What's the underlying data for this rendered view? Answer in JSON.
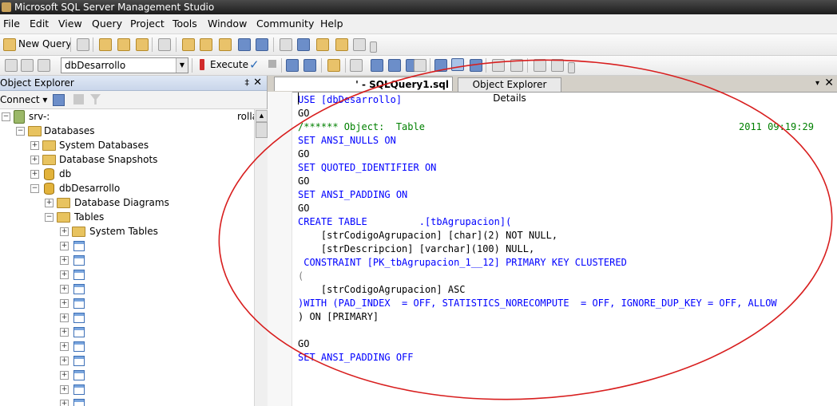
{
  "window": {
    "title": "Microsoft SQL Server Management Studio"
  },
  "menu": [
    "File",
    "Edit",
    "View",
    "Query",
    "Project",
    "Tools",
    "Window",
    "Community",
    "Help"
  ],
  "toolbar": {
    "new_query_label": "New Query",
    "database_selected": "dbDesarrollo",
    "execute_label": "Execute"
  },
  "object_explorer": {
    "title": "Object Explorer",
    "pin": "‡",
    "close": "✕",
    "connect_label": "Connect ▾",
    "tree": [
      {
        "label": "srv-:",
        "suffix": "rolla"
      },
      {
        "label": "Databases"
      },
      {
        "label": "System Databases"
      },
      {
        "label": "Database Snapshots"
      },
      {
        "label": "db"
      },
      {
        "label": "dbDesarrollo"
      },
      {
        "label": "Database Diagrams"
      },
      {
        "label": "Tables"
      },
      {
        "label": "System Tables"
      }
    ]
  },
  "editor": {
    "tab_active": "' - SQLQuery1.sql",
    "tab_other": "Object Explorer Details",
    "tab_arrow": "▾",
    "tab_close": "✕",
    "lines": [
      {
        "text": "USE [dbDesarrollo]",
        "color": "#0000ff"
      },
      {
        "text": "GO",
        "color": "#000000"
      },
      {
        "text": "/****** Object:  Table",
        "color": "#008000",
        "extra": "2011 09:19:29"
      },
      {
        "text": "SET ANSI_NULLS ON",
        "color": "#0000ff"
      },
      {
        "text": "GO",
        "color": "#000000"
      },
      {
        "text": "SET QUOTED_IDENTIFIER ON",
        "color": "#0000ff"
      },
      {
        "text": "GO",
        "color": "#000000"
      },
      {
        "text": "SET ANSI_PADDING ON",
        "color": "#0000ff"
      },
      {
        "text": "GO",
        "color": "#000000"
      },
      {
        "text": "CREATE TABLE         .[tbAgrupacion](",
        "color": "#0000ff"
      },
      {
        "text": "    [strCodigoAgrupacion] [char](2) NOT NULL,",
        "color": "#000000"
      },
      {
        "text": "    [strDescripcion] [varchar](100) NULL,",
        "color": "#000000"
      },
      {
        "text": " CONSTRAINT [PK_tbAgrupacion_1__12] PRIMARY KEY CLUSTERED",
        "color": "#0000ff"
      },
      {
        "text": "(",
        "color": "#808080"
      },
      {
        "text": "    [strCodigoAgrupacion] ASC",
        "color": "#000000"
      },
      {
        "text": ")WITH (PAD_INDEX  = OFF, STATISTICS_NORECOMPUTE  = OFF, IGNORE_DUP_KEY = OFF, ALLOW",
        "color": "#0000ff"
      },
      {
        "text": ") ON [PRIMARY]",
        "color": "#000000"
      },
      {
        "text": "",
        "color": "#000000"
      },
      {
        "text": "GO",
        "color": "#000000"
      },
      {
        "text": "SET ANSI_PADDING OFF",
        "color": "#0000ff"
      }
    ]
  },
  "annotation": {
    "color": "#d81e1e"
  }
}
